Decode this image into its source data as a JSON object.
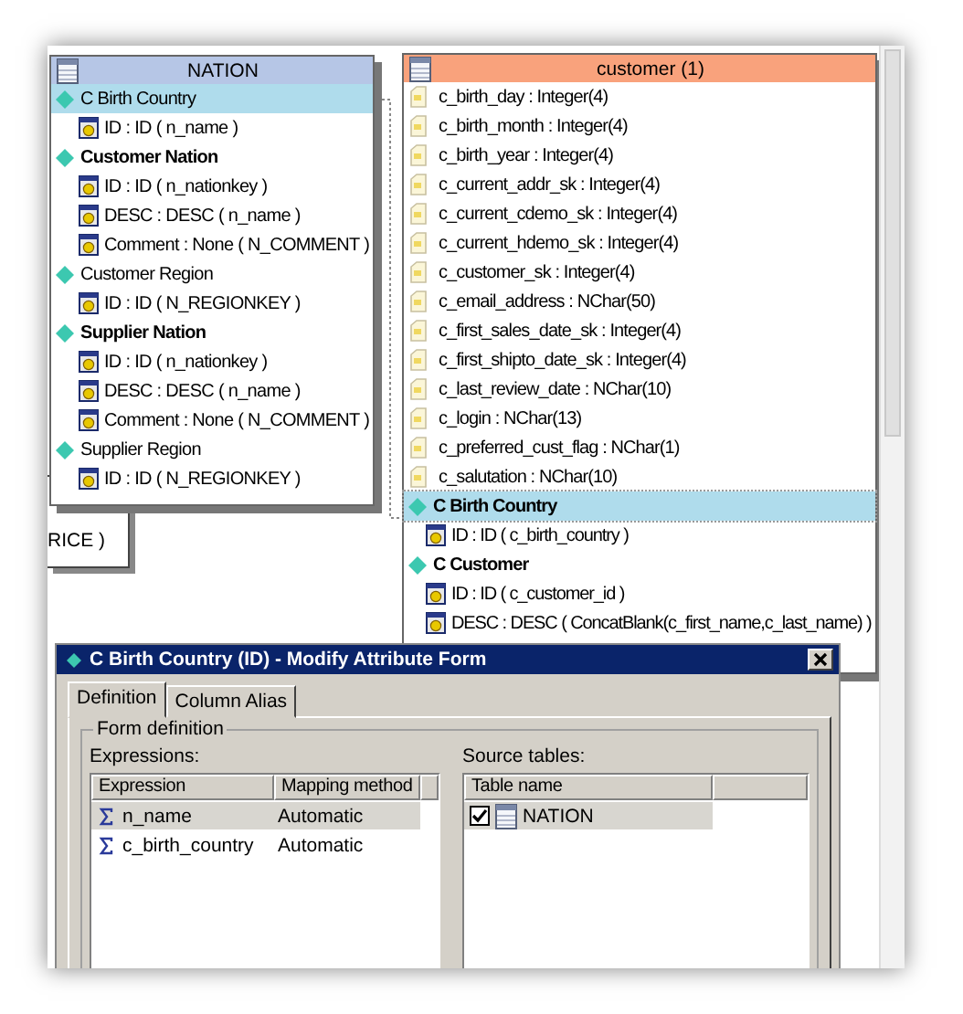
{
  "background_window": {
    "text": "RICE )"
  },
  "nation_table": {
    "title": "NATION",
    "attributes": [
      {
        "label": "C Birth Country",
        "bold": false,
        "selected": true,
        "children": [
          {
            "label": "ID : ID ( n_name )"
          }
        ]
      },
      {
        "label": "Customer Nation",
        "bold": true,
        "selected": false,
        "children": [
          {
            "label": "ID : ID ( n_nationkey )"
          },
          {
            "label": "DESC : DESC ( n_name )"
          },
          {
            "label": "Comment : None ( N_COMMENT )"
          }
        ]
      },
      {
        "label": "Customer Region",
        "bold": false,
        "selected": false,
        "children": [
          {
            "label": "ID : ID ( N_REGIONKEY )"
          }
        ]
      },
      {
        "label": "Supplier Nation",
        "bold": true,
        "selected": false,
        "children": [
          {
            "label": "ID : ID ( n_nationkey )"
          },
          {
            "label": "DESC : DESC ( n_name )"
          },
          {
            "label": "Comment : None ( N_COMMENT )"
          }
        ]
      },
      {
        "label": "Supplier Region",
        "bold": false,
        "selected": false,
        "children": [
          {
            "label": "ID : ID ( N_REGIONKEY )"
          }
        ]
      }
    ]
  },
  "customer_table": {
    "title": "customer (1)",
    "columns": [
      "c_birth_day : Integer(4)",
      "c_birth_month : Integer(4)",
      "c_birth_year : Integer(4)",
      "c_current_addr_sk : Integer(4)",
      "c_current_cdemo_sk : Integer(4)",
      "c_current_hdemo_sk : Integer(4)",
      "c_customer_sk : Integer(4)",
      "c_email_address : NChar(50)",
      "c_first_sales_date_sk : Integer(4)",
      "c_first_shipto_date_sk : Integer(4)",
      "c_last_review_date : NChar(10)",
      "c_login : NChar(13)",
      "c_preferred_cust_flag : NChar(1)",
      "c_salutation : NChar(10)"
    ],
    "attributes": [
      {
        "label": "C Birth Country",
        "bold": true,
        "selected": true,
        "children": [
          {
            "label": "ID : ID ( c_birth_country )"
          }
        ]
      },
      {
        "label": "C Customer",
        "bold": true,
        "selected": false,
        "children": [
          {
            "label": "ID : ID ( c_customer_id )"
          },
          {
            "label": "DESC : DESC ( ConcatBlank(c_first_name,c_last_name) )"
          }
        ]
      }
    ]
  },
  "dialog": {
    "title": "C Birth Country (ID) - Modify Attribute Form",
    "tabs": [
      {
        "label": "Definition",
        "selected": true
      },
      {
        "label": "Column Alias",
        "selected": false
      }
    ],
    "group": "Form definition",
    "expressions": {
      "label": "Expressions:",
      "columns": [
        "Expression",
        "Mapping method"
      ],
      "rows": [
        {
          "expression": "n_name",
          "mapping": "Automatic",
          "selected": true
        },
        {
          "expression": "c_birth_country",
          "mapping": "Automatic",
          "selected": false
        }
      ]
    },
    "source_tables": {
      "label": "Source tables:",
      "columns": [
        "Table name"
      ],
      "rows": [
        {
          "name": "NATION",
          "checked": true,
          "selected": true
        }
      ]
    }
  }
}
